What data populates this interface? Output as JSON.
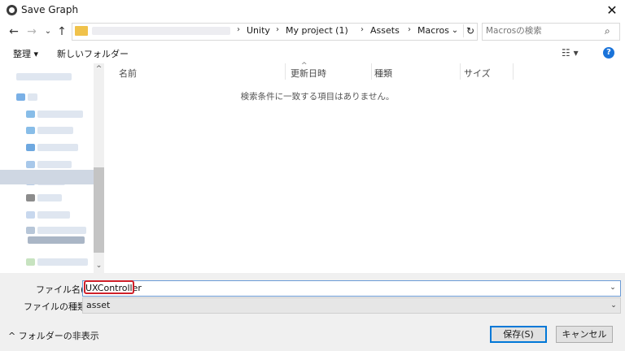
{
  "window": {
    "title": "Save Graph",
    "close_glyph": "✕"
  },
  "nav": {
    "back_glyph": "←",
    "forward_glyph": "→",
    "recent_glyph": "⌄",
    "up_glyph": "↑",
    "breadcrumbs": [
      "Unity",
      "My project (1)",
      "Assets",
      "Macros"
    ],
    "separator": "›",
    "dropdown_glyph": "⌄",
    "refresh_glyph": "↻"
  },
  "search": {
    "placeholder": "Macrosの検索",
    "icon_glyph": "⌕"
  },
  "toolbar": {
    "organize_label": "整理 ▾",
    "new_folder_label": "新しいフォルダー",
    "view_glyph": "☷ ▾",
    "help_glyph": "?"
  },
  "filelist": {
    "columns": [
      "名前",
      "更新日時",
      "種類",
      "サイズ"
    ],
    "sort_glyph": "^",
    "empty_message": "検索条件に一致する項目はありません。"
  },
  "scroll": {
    "up_glyph": "^",
    "down_glyph": "⌄"
  },
  "form": {
    "filename_label": "ファイル名(N):",
    "filename_value": "UXController",
    "filetype_label": "ファイルの種類(T):",
    "filetype_value": "asset",
    "dropdown_glyph": "⌄"
  },
  "footer": {
    "hide_folders_label": "^ フォルダーの非表示",
    "save_label": "保存(S)",
    "cancel_label": "キャンセル"
  },
  "colors": {
    "accent": "#0078d7",
    "highlight": "#d0202a",
    "folder": "#f0c24b"
  }
}
